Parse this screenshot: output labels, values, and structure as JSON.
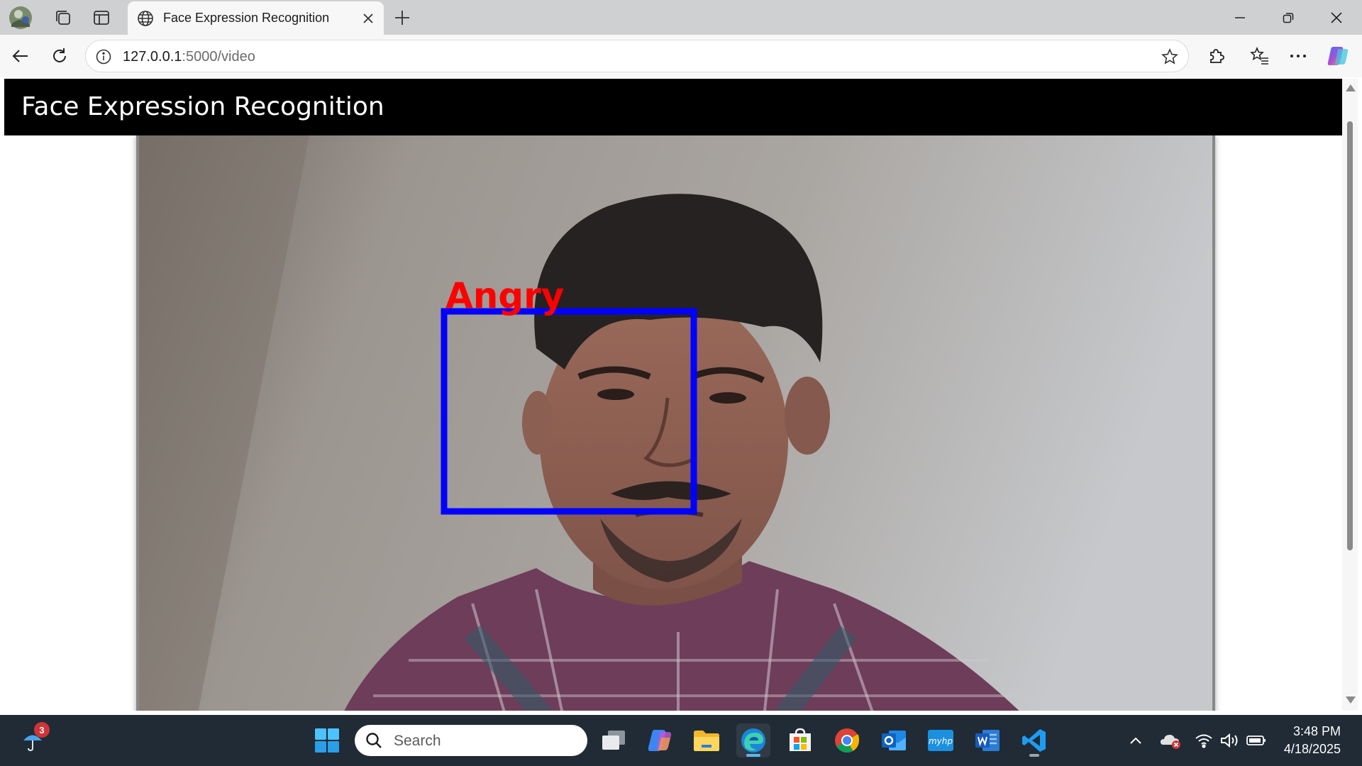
{
  "browser": {
    "tab_title": "Face Expression Recognition",
    "url_host": "127.0.0.1",
    "url_path": ":5000/video"
  },
  "page": {
    "header_title": "Face Expression Recognition",
    "detection": {
      "label": "Angry",
      "box_color": "#0000ff",
      "label_color": "#ff0000"
    }
  },
  "taskbar": {
    "weather_badge": "3",
    "search_placeholder": "Search",
    "clock_time": "3:48 PM",
    "clock_date": "4/18/2025"
  },
  "icons": {
    "tabstrip": [
      "profile-avatar-icon",
      "workspaces-icon",
      "vertical-tabs-icon",
      "globe-icon",
      "close-tab-icon",
      "new-tab-icon"
    ],
    "window": [
      "minimize-icon",
      "restore-icon",
      "close-window-icon"
    ],
    "toolbar": [
      "back-icon",
      "refresh-icon",
      "info-icon",
      "favorite-star-icon",
      "extensions-icon",
      "favorites-icon",
      "more-icon",
      "copilot-icon"
    ],
    "taskbar": [
      "weather-icon",
      "start-icon",
      "task-view-icon",
      "copilot-app-icon",
      "file-explorer-icon",
      "edge-icon",
      "store-icon",
      "chrome-icon",
      "outlook-icon",
      "myhp-icon",
      "word-icon",
      "vscode-icon"
    ],
    "tray": [
      "show-hidden-icons-icon",
      "onedrive-icon",
      "wifi-icon",
      "volume-icon",
      "battery-icon"
    ]
  }
}
